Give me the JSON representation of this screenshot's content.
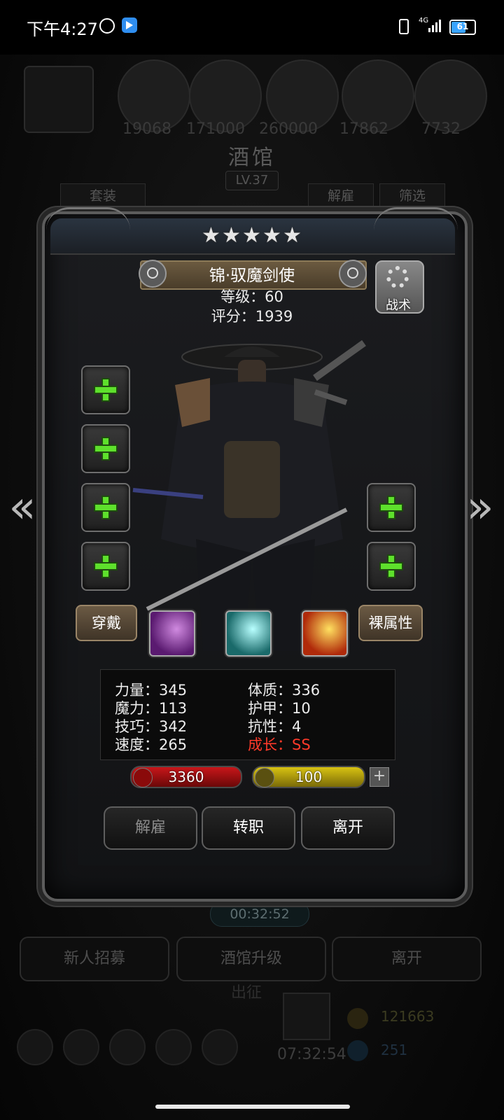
{
  "status_bar": {
    "time": "下午4:27",
    "network": "4G",
    "battery": "61",
    "battery_fraction": 0.61
  },
  "background": {
    "resources": [
      "19068",
      "171000",
      "260000",
      "17862",
      "7732"
    ],
    "title": "酒馆",
    "level": "LV.37",
    "tabs": {
      "suit": "套装",
      "dismiss": "解雇",
      "filter": "筛选"
    },
    "timer": "00:32:52",
    "buttons": [
      "新人招募",
      "酒馆升级",
      "离开"
    ],
    "dock_label": "出征",
    "dock_timer": "07:32:54",
    "gold": "121663",
    "gems": "251"
  },
  "hero": {
    "stars": 5,
    "name": "锦·驭魔剑使",
    "level": "等级：60",
    "score": "评分：1939",
    "tactic_label": "战术",
    "equip_button": "穿戴",
    "attr_button": "裸属性",
    "skills": [
      {
        "icon": "purple-slash-skill-icon",
        "color": "#7a3a9a"
      },
      {
        "icon": "cyan-wind-skill-icon",
        "color": "#2aa6a0"
      },
      {
        "icon": "flame-slash-skill-icon",
        "color": "#e06a18"
      }
    ],
    "left_slots": [
      "weapon-slot",
      "armor-slot",
      "accessory-slot",
      "accessory-slot"
    ],
    "right_slots": [
      "hourglass-slot",
      "hourglass-slot"
    ]
  },
  "stats": {
    "strength": "力量：345",
    "magic": "魔力：113",
    "skill": "技巧：342",
    "speed": "速度：265",
    "constitution": "体质：336",
    "armor": "护甲：10",
    "resistance": "抗性：4",
    "growth": "成长：SS"
  },
  "bars": {
    "hp": "3360",
    "energy": "100",
    "hp_color": "#c8161a",
    "energy_color": "#d8c312"
  },
  "actions": {
    "dismiss": "解雇",
    "change_job": "转职",
    "leave": "离开"
  }
}
